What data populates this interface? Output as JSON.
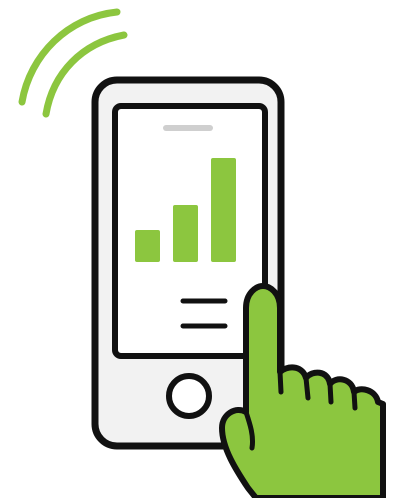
{
  "illustration": {
    "colors": {
      "outline": "#111111",
      "phone_fill": "#f2f2f2",
      "accent": "#8cc63f",
      "speaker": "#cfcfcf",
      "background": "#ffffff"
    },
    "icons": {
      "signal_waves": "signal-waves",
      "phone": "smartphone",
      "chart": "bar-chart",
      "hand": "pointing-hand"
    },
    "bar_chart": {
      "bar_count": 3,
      "levels": [
        0.31,
        0.55,
        1.0
      ]
    },
    "text_lines": 2
  }
}
